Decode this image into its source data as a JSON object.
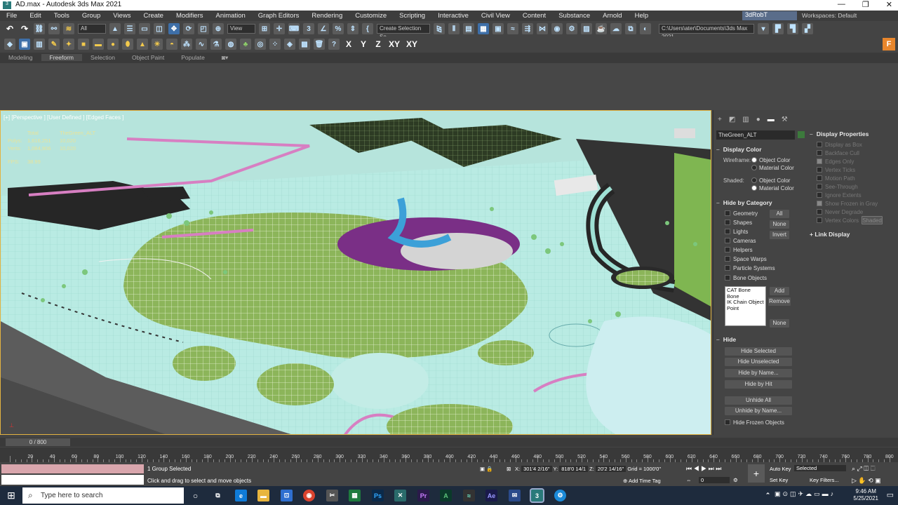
{
  "window": {
    "title": "AD.max - Autodesk 3ds Max 2021",
    "minimize": "—",
    "restore": "❐",
    "close": "✕"
  },
  "menu": [
    "File",
    "Edit",
    "Tools",
    "Group",
    "Views",
    "Create",
    "Modifiers",
    "Animation",
    "Graph Editors",
    "Rendering",
    "Customize",
    "Scripting",
    "Interactive",
    "Civil View",
    "Content",
    "Substance",
    "Arnold",
    "Help"
  ],
  "user": "3dRobT",
  "workspace": "Workspaces: Default",
  "toolbar": {
    "filter": "All",
    "refcoord": "View",
    "selection_set": "Create Selection Se",
    "path": "C:\\Users\\ater\\Documents\\3ds Max 2021",
    "axes": [
      "X",
      "Y",
      "Z",
      "XY",
      "XY"
    ]
  },
  "ribbon": {
    "tabs": [
      "Modeling",
      "Freeform",
      "Selection",
      "Object Paint",
      "Populate"
    ],
    "active": "Freeform"
  },
  "viewport": {
    "label": "[+] [Perspective ] [User Defined ] [Edged Faces ]",
    "stats": {
      "header_total": "Total",
      "header_obj": "TheGreen_ALT",
      "polys_label": "Polys:",
      "polys_total": "1,616,251",
      "polys_obj": "10,020",
      "verts_label": "Verts:",
      "verts_total": "1,084,906",
      "verts_obj": "10,020",
      "fps_label": "FPS:",
      "fps_value": "38.99"
    }
  },
  "cmdpanel": {
    "object_name": "TheGreen_ALT",
    "display_color": "Display Color",
    "wireframe": "Wireframe:",
    "shaded": "Shaded:",
    "object_color": "Object Color",
    "material_color": "Material Color",
    "hide_by_category": "Hide by Category",
    "categories": [
      "Geometry",
      "Shapes",
      "Lights",
      "Cameras",
      "Helpers",
      "Space Warps",
      "Particle Systems",
      "Bone Objects"
    ],
    "cat_buttons": [
      "All",
      "None",
      "Invert"
    ],
    "bone_list": [
      "CAT Bone",
      "Bone",
      "IK Chain Object",
      "Point"
    ],
    "list_buttons": [
      "Add",
      "Remove",
      "None"
    ],
    "hide": "Hide",
    "hide_buttons": [
      "Hide Selected",
      "Hide Unselected",
      "Hide by Name...",
      "Hide by Hit",
      "Unhide All",
      "Unhide by Name..."
    ],
    "hide_frozen": "Hide Frozen Objects"
  },
  "display_props": {
    "title": "Display Properties",
    "items": [
      "Display as Box",
      "Backface Cull",
      "Edges Only",
      "Vertex Ticks",
      "Motion Path",
      "See-Through",
      "Ignore Extents",
      "Show Frozen in Gray",
      "Never Degrade",
      "Vertex Colors"
    ],
    "shaded_btn": "Shaded",
    "link_display": "Link Display"
  },
  "timeline": {
    "slider": "0 / 800",
    "ticks": [
      0,
      20,
      40,
      60,
      80,
      100,
      120,
      140,
      160,
      180,
      200,
      220,
      240,
      260,
      280,
      300,
      320,
      340,
      360,
      380,
      400,
      420,
      440,
      460,
      480,
      500,
      520,
      540,
      560,
      580,
      600,
      620,
      640,
      660,
      680,
      700,
      720,
      740,
      760,
      780,
      800
    ]
  },
  "status": {
    "selection": "1 Group Selected",
    "prompt": "Click and drag to select and move objects",
    "x_label": "X:",
    "x": "301'4 2/16\"",
    "y_label": "Y:",
    "y": "818'0 14/1",
    "z_label": "Z:",
    "z": "20'2 14/16\"",
    "grid": "Grid = 1000'0\"",
    "add_time_tag": "Add Time Tag",
    "auto_key": "Auto Key",
    "set_key": "Set Key",
    "selected": "Selected",
    "key_filters": "Key Filters...",
    "frame": "0"
  },
  "taskbar": {
    "search": "Type here to search",
    "time": "9:46 AM",
    "date": "5/25/2021"
  }
}
